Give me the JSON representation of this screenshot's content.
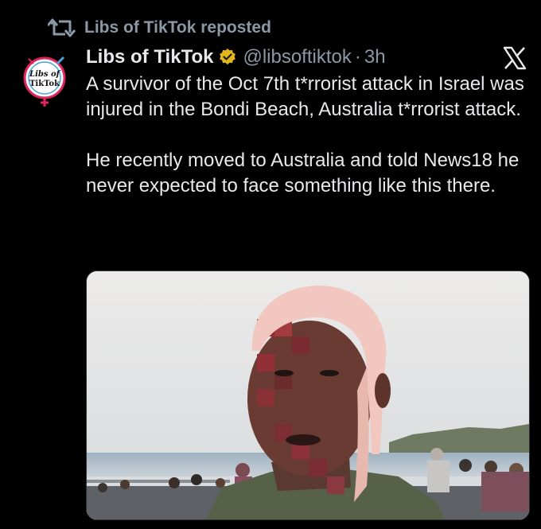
{
  "repost": {
    "label": "Libs of TikTok reposted",
    "icon": "repost-icon"
  },
  "author": {
    "display_name": "Libs of TikTok",
    "handle": "@libsoftiktok",
    "separator": "·",
    "time": "3h",
    "verified_icon": "verified-badge-icon",
    "verified_color": "#e2b719",
    "avatar_text_top": "Libs of",
    "avatar_text_bottom": "TikTok",
    "avatar_ring_color": "#e0245e"
  },
  "platform_icon": "x-logo-icon",
  "tweet": {
    "paragraphs": [
      "A survivor of the Oct 7th t*rrorist attack in Israel was injured in the Bondi Beach, Australia t*rrorist attack.",
      "He recently moved to Australia and told News18 he never expected to face something like this there."
    ]
  },
  "media": {
    "type": "photo"
  },
  "colors": {
    "background": "#000000",
    "text": "#e7e9ea",
    "secondary_text": "#8b98a5"
  }
}
